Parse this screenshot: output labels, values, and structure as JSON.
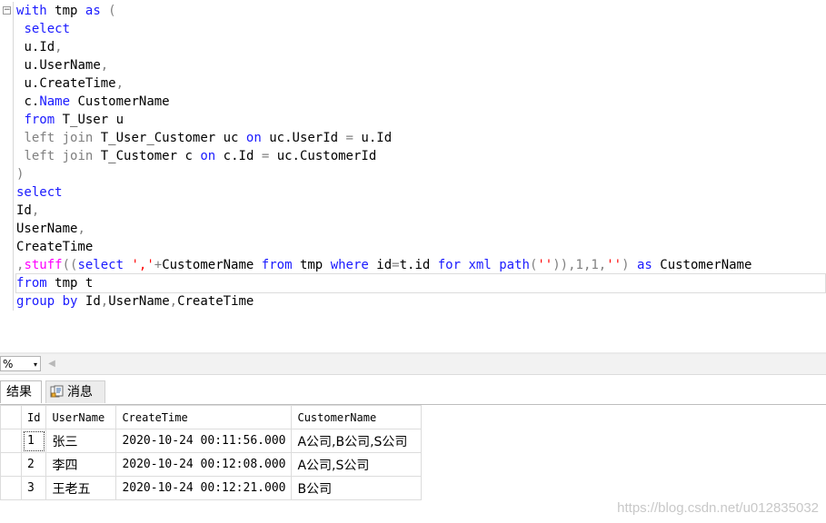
{
  "editor": {
    "lines": [
      "with tmp as (",
      " select",
      " u.Id,",
      " u.UserName,",
      " u.CreateTime,",
      " c.Name CustomerName",
      " from T_User u",
      " left join T_User_Customer uc on uc.UserId = u.Id",
      " left join T_Customer c on c.Id = uc.CustomerId",
      ")",
      "select",
      "Id,",
      "UserName,",
      "CreateTime",
      ",stuff((select ','+CustomerName from tmp where id=t.id for xml path('')),1,1,'') as CustomerName",
      "from tmp t",
      "group by Id,UserName,CreateTime"
    ],
    "fold_glyph": "−"
  },
  "zoom": {
    "value": "%",
    "arrow": "▾"
  },
  "scroll_left_glyph": "◀",
  "tabs": {
    "results": "结果",
    "messages": "消息"
  },
  "grid": {
    "columns": [
      "Id",
      "UserName",
      "CreateTime",
      "CustomerName"
    ],
    "rows": [
      [
        "1",
        "张三",
        "2020-10-24 00:11:56.000",
        "A公司,B公司,S公司"
      ],
      [
        "2",
        "李四",
        "2020-10-24 00:12:08.000",
        "A公司,S公司"
      ],
      [
        "3",
        "王老五",
        "2020-10-24 00:12:21.000",
        "B公司"
      ]
    ]
  },
  "watermark": "https://blog.csdn.net/u012835032",
  "colors": {
    "keyword": "#1a1aff",
    "function": "#ff00ff",
    "string": "#ff0000",
    "operator": "#808080"
  },
  "icons": {
    "fold": "collapse-icon",
    "messages": "messages-icon"
  }
}
